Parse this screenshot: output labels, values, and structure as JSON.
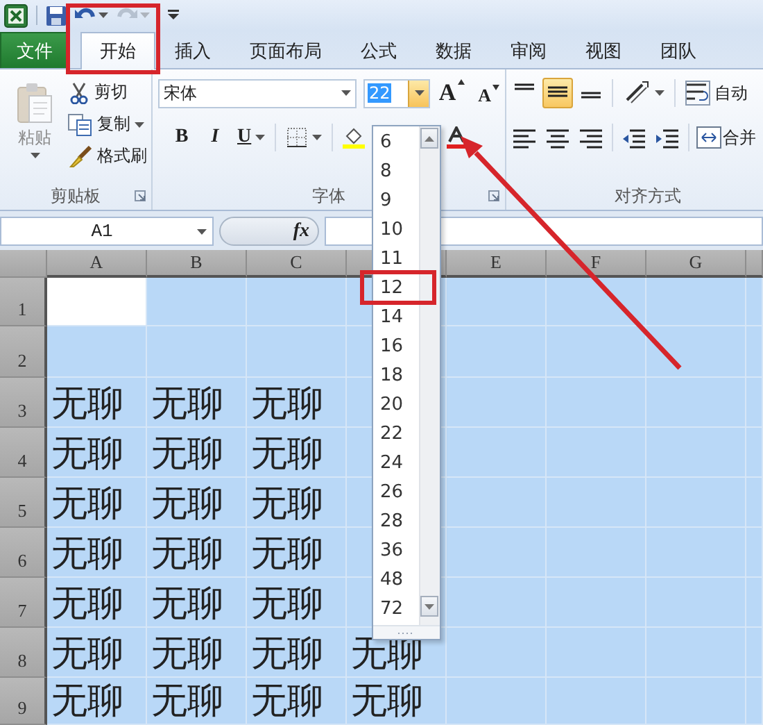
{
  "quick_access": [
    {
      "kind": "save",
      "disabled": false
    },
    {
      "kind": "undo",
      "disabled": false
    },
    {
      "kind": "redo",
      "disabled": true
    }
  ],
  "tabs": [
    {
      "label": "文件",
      "kind": "file",
      "selected": false
    },
    {
      "label": "开始",
      "kind": "tab",
      "selected": true
    },
    {
      "label": "插入",
      "kind": "tab",
      "selected": false
    },
    {
      "label": "页面布局",
      "kind": "tab",
      "selected": false
    },
    {
      "label": "公式",
      "kind": "tab",
      "selected": false
    },
    {
      "label": "数据",
      "kind": "tab",
      "selected": false
    },
    {
      "label": "审阅",
      "kind": "tab",
      "selected": false
    },
    {
      "label": "视图",
      "kind": "tab",
      "selected": false
    },
    {
      "label": "团队",
      "kind": "tab",
      "selected": false
    }
  ],
  "clipboard": {
    "label": "剪贴板",
    "paste": {
      "label": "粘贴",
      "disabled": true
    },
    "cut": "剪切",
    "copy": "复制",
    "format_painter": "格式刷"
  },
  "font": {
    "label": "字体",
    "name": "宋体",
    "size": "22",
    "grow": "A",
    "shrink": "A",
    "bold": "B",
    "italic": "I",
    "underline": "U"
  },
  "alignment": {
    "label": "对齐方式",
    "wrap_text": "自动",
    "merge": "合并",
    "vertical": [
      {
        "kind": "top",
        "selected": false
      },
      {
        "kind": "middle",
        "selected": true
      },
      {
        "kind": "bottom",
        "selected": false
      }
    ]
  },
  "formula_bar": {
    "name_box": "A1",
    "function_symbol": "fx"
  },
  "sheet": {
    "columns": [
      {
        "label": "A"
      },
      {
        "label": "B"
      },
      {
        "label": "C"
      },
      {
        "covered": true
      },
      {
        "label": "E"
      },
      {
        "label": "F"
      },
      {
        "label": "G"
      }
    ],
    "all_selected": true,
    "rows": [
      {
        "header": "1"
      },
      {
        "header": "2"
      },
      {
        "header": "3",
        "cells": [
          "无聊",
          "无聊",
          "无聊"
        ]
      },
      {
        "header": "4",
        "cells": [
          "无聊",
          "无聊",
          "无聊"
        ]
      },
      {
        "header": "5",
        "cells": [
          "无聊",
          "无聊",
          "无聊"
        ]
      },
      {
        "header": "6",
        "cells": [
          "无聊",
          "无聊",
          "无聊"
        ]
      },
      {
        "header": "7",
        "cells": [
          "无聊",
          "无聊",
          "无聊"
        ]
      },
      {
        "header": "8",
        "cells": [
          "无聊",
          "无聊",
          "无聊",
          "无聊"
        ]
      },
      {
        "header": "9",
        "cells": [
          "无聊",
          "无聊",
          "无聊",
          "无聊"
        ]
      }
    ]
  },
  "font_size_list": [
    "6",
    "8",
    "9",
    "10",
    "11",
    "12",
    "14",
    "16",
    "18",
    "20",
    "22",
    "24",
    "26",
    "28",
    "36",
    "48",
    "72"
  ],
  "annotations": [
    {
      "kind": "box"
    },
    {
      "kind": "box"
    },
    {
      "kind": "arrow"
    }
  ]
}
